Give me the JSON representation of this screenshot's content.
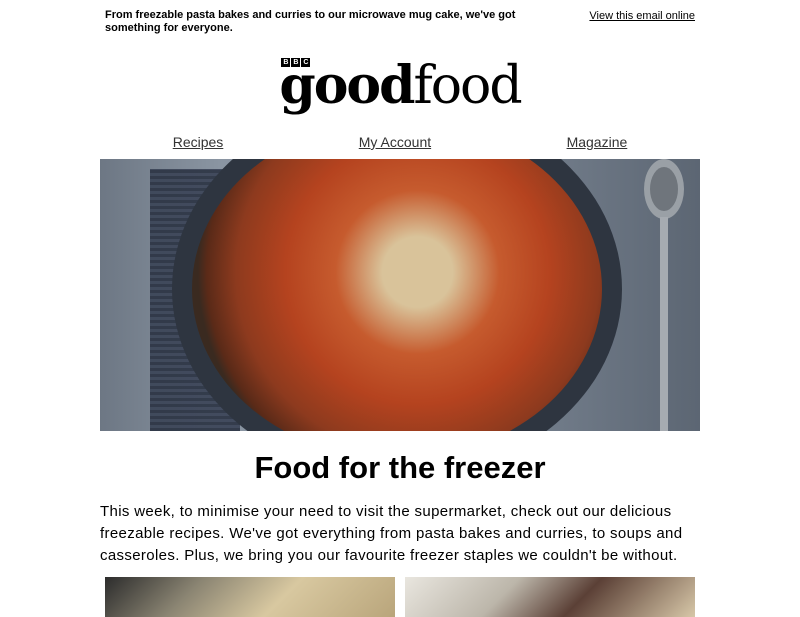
{
  "preheader": {
    "text": "From freezable pasta bakes and curries to our microwave mug cake, we've got something for everyone.",
    "view_online": "View this email online"
  },
  "logo": {
    "bbc": [
      "B",
      "B",
      "C"
    ],
    "word_good": "good",
    "word_food": "food"
  },
  "nav": {
    "items": [
      {
        "label": "Recipes"
      },
      {
        "label": "My Account"
      },
      {
        "label": "Magazine"
      }
    ]
  },
  "hero": {
    "title": "Food for the freezer",
    "body": "This week, to minimise your need to visit the supermarket, check out our delicious freezable recipes. We've got everything from pasta bakes and curries, to soups and casseroles. Plus, we bring you our favourite freezer staples we couldn't be without."
  }
}
